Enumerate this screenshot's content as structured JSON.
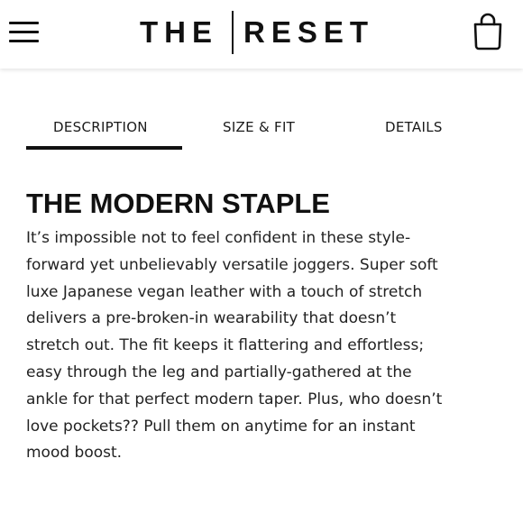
{
  "header": {
    "logo_left": "THE",
    "logo_right": "RESET",
    "menu_icon": "hamburger-menu-icon",
    "cart_icon": "shopping-bag-icon"
  },
  "tabs": [
    {
      "label": "DESCRIPTION",
      "active": true
    },
    {
      "label": "SIZE & FIT",
      "active": false
    },
    {
      "label": "DETAILS",
      "active": false
    }
  ],
  "content": {
    "title": "THE MODERN STAPLE",
    "lines": [
      "It’s impossible not to feel confident in these style-",
      "forward yet unbelievably versatile joggers. Super soft",
      "luxe Japanese vegan leather with a touch of stretch",
      "delivers a pre-broken-in wearability that doesn’t",
      "stretch out. The fit keeps it flattering and effortless;",
      "easy through the leg and partially-gathered at the",
      "ankle for that perfect modern taper. Plus, who doesn’t",
      "love pockets?? Pull them on anytime for an instant",
      "mood boost."
    ]
  },
  "colors": {
    "text": "#111111",
    "background": "#ffffff",
    "active_tab_underline": "#111111"
  }
}
